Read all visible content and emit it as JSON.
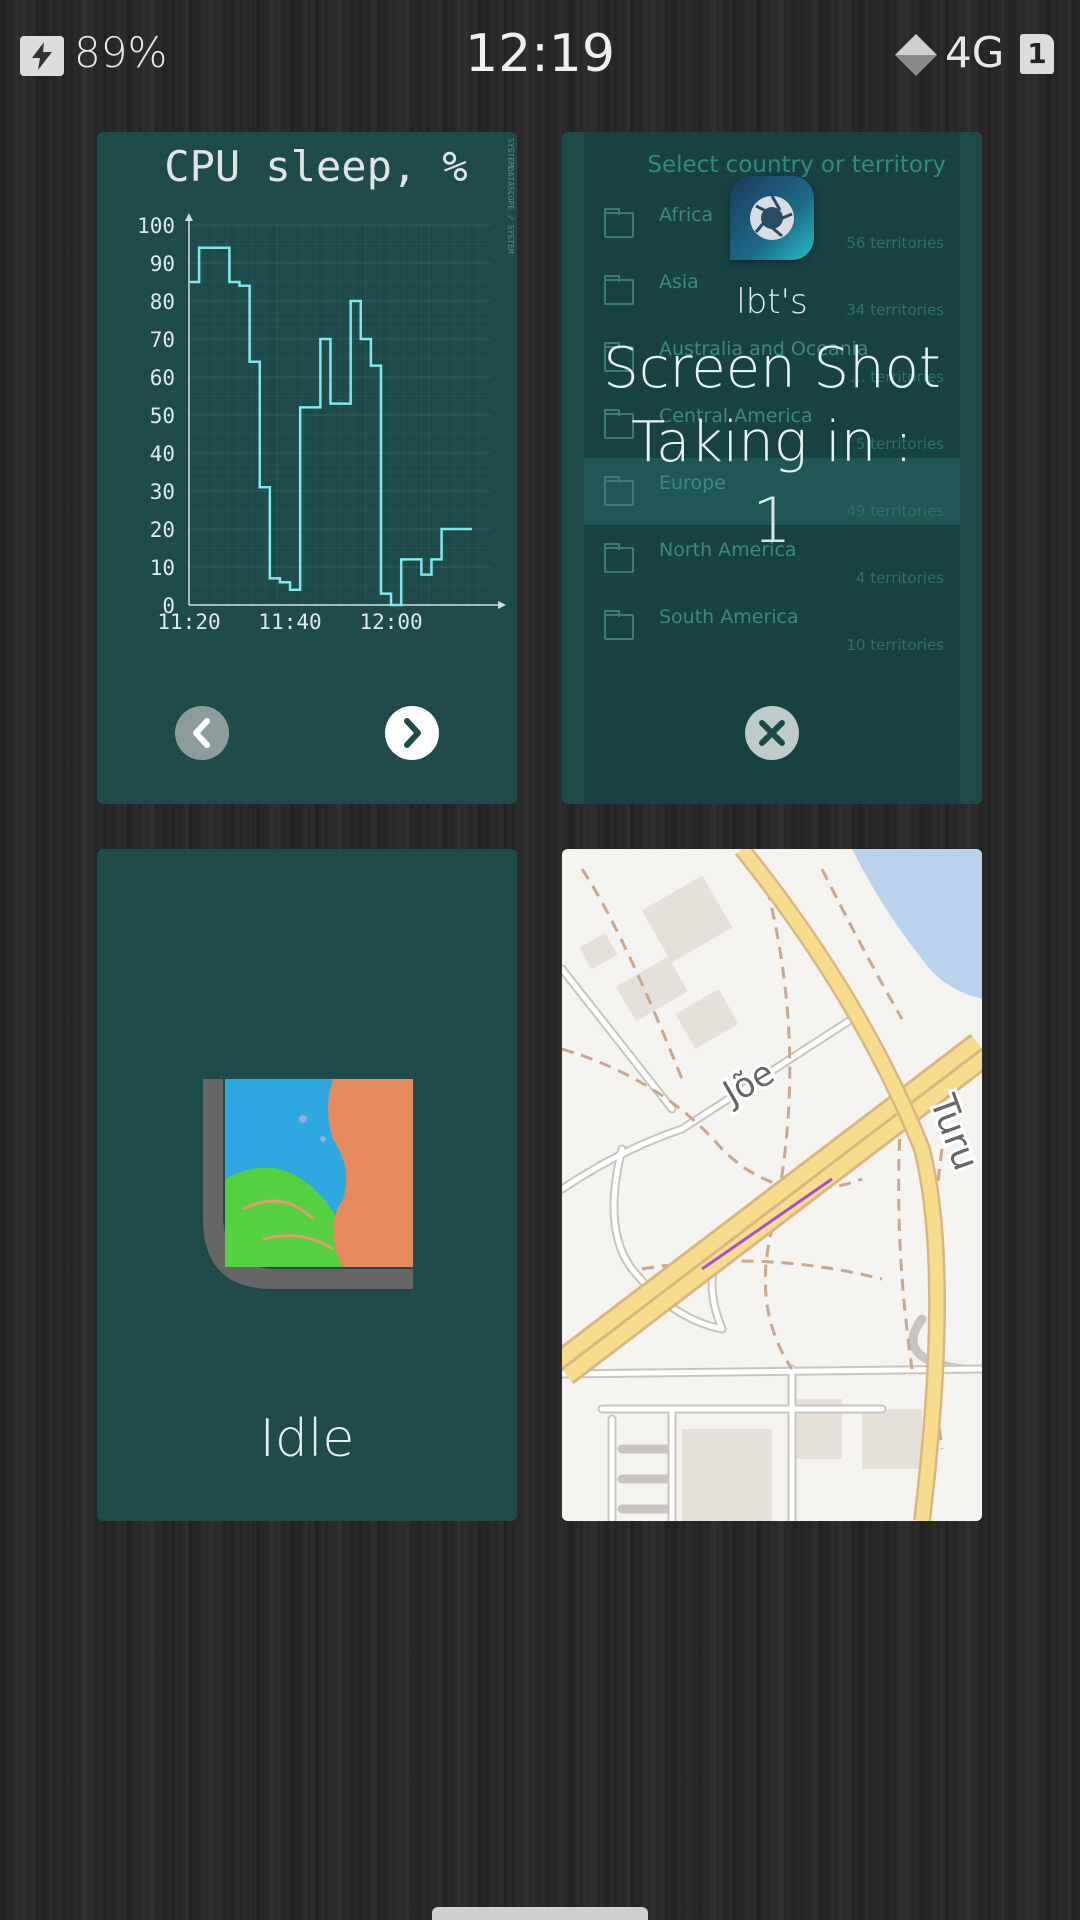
{
  "status_bar": {
    "battery": "89%",
    "time": "12:19",
    "network": "4G",
    "sim": "1",
    "icons": [
      "charging-bolt-icon",
      "signal-icon",
      "sim-card-icon"
    ]
  },
  "cards": {
    "cpu": {
      "title": "CPU sleep, %",
      "side_text": "SYSTEMDATASCOPE / SYSTEM",
      "prev_icon": "chevron-left-icon",
      "next_icon": "chevron-right-icon"
    },
    "screenshot": {
      "header": "Select country or territory",
      "owner": "lbt's",
      "title_line1": "Screen Shot",
      "title_line2": "Taking in :",
      "countdown": "1",
      "rows": [
        {
          "name": "Africa",
          "sub": "56 territories"
        },
        {
          "name": "Asia",
          "sub": "34 territories"
        },
        {
          "name": "Australia and Oceania",
          "sub": "… territories"
        },
        {
          "name": "Central America",
          "sub": "5 territories"
        },
        {
          "name": "Europe",
          "sub": "49 territories"
        },
        {
          "name": "North America",
          "sub": "4 territories"
        },
        {
          "name": "South America",
          "sub": "10 territories"
        }
      ],
      "close_icon": "close-icon"
    },
    "idle": {
      "label": "Idle"
    },
    "map": {
      "street1": "Jõe",
      "street2": "Turu"
    }
  },
  "chart_data": {
    "type": "line",
    "title": "CPU sleep, %",
    "xlabel": "",
    "ylabel": "",
    "ylim": [
      0,
      100
    ],
    "yticks": [
      0,
      10,
      20,
      30,
      40,
      50,
      60,
      70,
      80,
      90,
      100
    ],
    "xticks": [
      "11:20",
      "11:40",
      "12:00"
    ],
    "x_minutes": [
      0,
      2,
      4,
      6,
      8,
      10,
      12,
      14,
      16,
      18,
      20,
      22,
      24,
      26,
      28,
      30,
      32,
      34,
      36,
      38,
      40,
      42,
      44,
      46,
      48,
      50,
      52,
      54,
      56
    ],
    "series": [
      {
        "values": [
          85,
          94,
          94,
          94,
          85,
          84,
          64,
          31,
          7,
          6,
          4,
          52,
          52,
          70,
          53,
          53,
          80,
          70,
          63,
          3,
          0,
          12,
          12,
          8,
          12,
          20,
          20,
          20,
          20
        ]
      }
    ],
    "color": "#7fe7ee"
  },
  "colors": {
    "card_bg": "#1e4a4a",
    "chart_line": "#7fe7ee",
    "map_bg": "#f5f3f0",
    "road_major": "#f8dc8e"
  }
}
